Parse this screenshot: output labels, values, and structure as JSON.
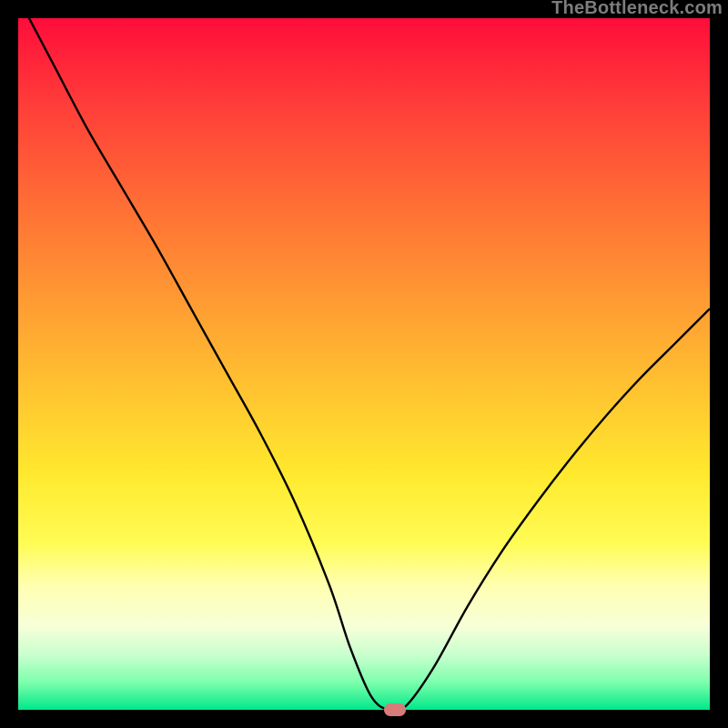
{
  "watermark": "TheBottleneck.com",
  "colors": {
    "frame": "#000000",
    "marker": "#d77b7b",
    "curve": "#000000",
    "gradient_stops": [
      "#ff0d3a",
      "#ff3b39",
      "#ff6b35",
      "#ff9833",
      "#ffc430",
      "#ffe92e",
      "#fffc55",
      "#ffffb0",
      "#f6ffd8",
      "#c9ffce",
      "#7effad",
      "#00e88a"
    ]
  },
  "chart_data": {
    "type": "line",
    "title": "",
    "xlabel": "",
    "ylabel": "",
    "xlim": [
      0,
      100
    ],
    "ylim": [
      0,
      100
    ],
    "grid": false,
    "series": [
      {
        "name": "curve",
        "x": [
          0,
          5,
          10,
          15,
          20,
          25,
          30,
          35,
          40,
          45,
          48,
          51,
          53.5,
          56,
          60,
          65,
          70,
          75,
          80,
          85,
          90,
          95,
          100
        ],
        "y": [
          103,
          93.5,
          84,
          75.5,
          67,
          58,
          49,
          40,
          30,
          18,
          9,
          2,
          0,
          0.5,
          6,
          15,
          23,
          30,
          36.5,
          42.5,
          48,
          53,
          58
        ]
      }
    ],
    "marker": {
      "x": 54.5,
      "y": 0,
      "shape": "pill"
    },
    "notes": "Axes are unlabeled in the source image; x and y are normalized 0–100. y=0 is the bottom edge (green), y=100 is the top edge (red). Values estimated from pixel positions."
  }
}
